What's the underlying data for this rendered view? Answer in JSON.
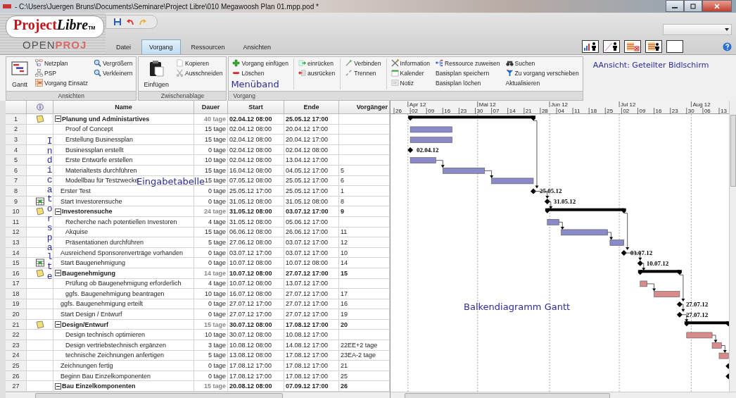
{
  "window": {
    "title": "- C:\\Users\\Juergen Bruns\\Documents\\Seminare\\Project Libre\\010 Megawoosh Plan 01.mpp.pod *"
  },
  "logo": {
    "parts": [
      "Project",
      "Libre"
    ],
    "tm": "TM",
    "subtitle": [
      "OPEN",
      "PROJ"
    ]
  },
  "tabs": [
    {
      "label": "Datei",
      "selected": false
    },
    {
      "label": "Vorgang",
      "selected": true
    },
    {
      "label": "Ressourcen",
      "selected": false
    },
    {
      "label": "Ansichten",
      "selected": false
    }
  ],
  "ribbon": {
    "groups": [
      {
        "label": "Ansichten",
        "large": "Gantt",
        "columns": [
          [
            "Netzplan",
            "PSP",
            "Vorgang Einsatz"
          ],
          [
            "Vergrößern",
            "Verkleinern"
          ]
        ]
      },
      {
        "label": "Zwischenablage",
        "large": "Einfügen",
        "columns": [
          [
            "Kopieren",
            "Ausschneiden"
          ]
        ]
      },
      {
        "label": "Vorgang",
        "columns": [
          [
            "Vorgang einfügen",
            "Löschen"
          ],
          [
            "einrücken",
            "ausrücken"
          ],
          [
            "Verbinden",
            "Trennen"
          ],
          [
            "Information",
            "Kalender",
            "Notiz"
          ],
          [
            "Ressource zuweisen",
            "Basisplan speichern",
            "Basisplan löchen"
          ],
          [
            "Suchen",
            "Zu vorgang verschieben",
            "Aktualisieren"
          ]
        ]
      }
    ],
    "annotation": "Menüband",
    "view_annotation": "AAnsicht: Geteilter Bidlschirm"
  },
  "table": {
    "columns": [
      "Name",
      "Dauer",
      "Start",
      "Ende",
      "Vorgänger"
    ],
    "annotation": "Eingabetabelle",
    "indicator_annotation": "Indicatorspalte",
    "rows": [
      {
        "id": "1",
        "kind": "summary",
        "expanded": true,
        "note": true,
        "name": "Planung und Administartives",
        "duration": "40 tage",
        "start": "02.04.12 08:00",
        "end": "25.05.12 17:00",
        "children": [
          {
            "id": "2",
            "kind": "task",
            "name": "Proof of Concept",
            "duration": "15 tage",
            "start": "02.04.12 08:00",
            "end": "20.04.12 17:00",
            "color": "#8a8ac8"
          },
          {
            "id": "3",
            "kind": "task",
            "name": "Erstellung Businessplan",
            "duration": "15 tage",
            "start": "02.04.12 08:00",
            "end": "20.04.12 17:00",
            "color": "#8a8ac8"
          },
          {
            "id": "4",
            "kind": "milestone",
            "name": "Businessplan erstellt",
            "duration": "0 tage",
            "start": "02.04.12 08:00",
            "end": "02.04.12 08:00",
            "gantt_label": "02.04.12"
          },
          {
            "id": "5",
            "kind": "task",
            "name": "Erste Entwürfe erstellen",
            "duration": "10 tage",
            "start": "02.04.12 08:00",
            "end": "13.04.12 17:00",
            "color": "#8a8ac8"
          },
          {
            "id": "6",
            "kind": "task",
            "name": "Materialtests durchführen",
            "duration": "15 tage",
            "start": "16.04.12 08:00",
            "end": "04.05.12 17:00",
            "predecessors": "5",
            "color": "#8a8ac8"
          },
          {
            "id": "7",
            "kind": "task",
            "name": "Modellbau für Testzwecke",
            "duration": "15 tage",
            "start": "07.05.12 08:00",
            "end": "25.05.12 17:00",
            "predecessors": "6",
            "color": "#8a8ac8"
          }
        ]
      },
      {
        "id": "8",
        "kind": "milestone",
        "name": "Erster Test",
        "duration": "0 tage",
        "start": "25.05.12 17:00",
        "end": "25.05.12 17:00",
        "predecessors": "1",
        "gantt_label": "25.05.12"
      },
      {
        "id": "9",
        "kind": "milestone",
        "constraint": true,
        "name": "Start Investorensuche",
        "duration": "0 tage",
        "start": "31.05.12 08:00",
        "end": "31.05.12 08:00",
        "predecessors": "8",
        "gantt_label": "31.05.12"
      },
      {
        "id": "10",
        "kind": "summary",
        "expanded": true,
        "note": true,
        "name": "Investorensuche",
        "duration": "24 tage",
        "start": "31.05.12 08:00",
        "end": "03.07.12 17:00",
        "predecessors": "9",
        "children": [
          {
            "id": "11",
            "kind": "task",
            "name": "Recherche nach potentiellen Investoren",
            "duration": "4 tage",
            "start": "31.05.12 08:00",
            "end": "05.06.12 17:00",
            "color": "#8a8ac8"
          },
          {
            "id": "12",
            "kind": "task",
            "name": "Akquise",
            "duration": "15 tage",
            "start": "06.06.12 08:00",
            "end": "26.06.12 17:00",
            "predecessors": "11",
            "color": "#8a8ac8"
          },
          {
            "id": "13",
            "kind": "task",
            "name": "Präsentationen durchführen",
            "duration": "5 tage",
            "start": "27.06.12 08:00",
            "end": "03.07.12 17:00",
            "predecessors": "12",
            "color": "#8a8ac8"
          }
        ]
      },
      {
        "id": "14",
        "kind": "milestone",
        "name": "Ausreichend Sponsorenverträge vorhanden",
        "duration": "0 tage",
        "start": "03.07.12 17:00",
        "end": "03.07.12 17:00",
        "predecessors": "10",
        "gantt_label": "03.07.12"
      },
      {
        "id": "15",
        "kind": "milestone",
        "constraint": true,
        "name": "Start Baugenehmigung",
        "duration": "0 tage",
        "start": "10.07.12 08:00",
        "end": "10.07.12 08:00",
        "predecessors": "14",
        "gantt_label": "10.07.12"
      },
      {
        "id": "16",
        "kind": "summary",
        "expanded": true,
        "note": true,
        "name": "Baugenehmigung",
        "duration": "14 tage",
        "start": "10.07.12 08:00",
        "end": "27.07.12 17:00",
        "predecessors": "15",
        "children": [
          {
            "id": "17",
            "kind": "task",
            "name": "Prüfung ob Baugenehmigung erforderlich",
            "duration": "4 tage",
            "start": "10.07.12 08:00",
            "end": "13.07.12 17:00",
            "color": "#d98a8a"
          },
          {
            "id": "18",
            "kind": "task",
            "name": "ggfs. Baugenehmigung beantragen",
            "duration": "10 tage",
            "start": "16.07.12 08:00",
            "end": "27.07.12 17:00",
            "predecessors": "17",
            "color": "#d98a8a"
          }
        ]
      },
      {
        "id": "19",
        "kind": "milestone",
        "name": "ggfs. Baugenehmigung erteilt",
        "duration": "0 tage",
        "start": "27.07.12 17:00",
        "end": "27.07.12 17:00",
        "predecessors": "16",
        "gantt_label": "27.07.12"
      },
      {
        "id": "20",
        "kind": "milestone",
        "name": "Start Design / Entwurf",
        "duration": "0 tage",
        "start": "27.07.12 17:00",
        "end": "27.07.12 17:00",
        "predecessors": "19",
        "gantt_label": "27.07.12"
      },
      {
        "id": "21",
        "kind": "summary",
        "expanded": true,
        "note": true,
        "name": "Design/Entwurf",
        "duration": "15 tage",
        "start": "30.07.12 08:00",
        "end": "17.08.12 17:00",
        "predecessors": "20",
        "children": [
          {
            "id": "22",
            "kind": "task",
            "name": "Design technisch optimieren",
            "duration": "10 tage",
            "start": "30.07.12 08:00",
            "end": "10.08.12 17:00",
            "color": "#d98a8a"
          },
          {
            "id": "23",
            "kind": "task",
            "name": "Design vertriebstechnisch ergänzen",
            "duration": "3 tage",
            "start": "10.08.12 08:00",
            "end": "14.08.12 17:00",
            "predecessors": "22EE+2 tage",
            "color": "#d98a8a"
          },
          {
            "id": "24",
            "kind": "task",
            "name": "technische Zeichnungen anfertigen",
            "duration": "5 tage",
            "start": "13.08.12 08:00",
            "end": "17.08.12 17:00",
            "predecessors": "23EA-2 tage",
            "color": "#d98a8a"
          }
        ]
      },
      {
        "id": "25",
        "kind": "milestone",
        "name": "Zeichnungen fertig",
        "duration": "0 tage",
        "start": "17.08.12 17:00",
        "end": "17.08.12 17:00",
        "predecessors": "21"
      },
      {
        "id": "26",
        "kind": "milestone",
        "name": "Beginn Bau Einzelkomponenten",
        "duration": "0 tage",
        "start": "17.08.12 17:00",
        "end": "17.08.12 17:00",
        "predecessors": "25"
      },
      {
        "id": "27",
        "kind": "summary",
        "expanded": true,
        "name": "Bau Einzelkomponenten",
        "duration": "15 tage",
        "start": "20.08.12 08:00",
        "end": "07.09.12 17:00",
        "predecessors": "26"
      }
    ]
  },
  "gantt": {
    "months": [
      "Apr 12",
      "Mai 12",
      "Jun 12",
      "Jul 12",
      "Aug 12"
    ],
    "weeks": [
      "26",
      "02",
      "09",
      "16",
      "23",
      "30",
      "07",
      "14",
      "21",
      "28",
      "04",
      "11",
      "18",
      "25",
      "02",
      "09",
      "16",
      "23",
      "30",
      "06",
      "13"
    ],
    "annotation": "Balkendiagramm Gantt"
  }
}
